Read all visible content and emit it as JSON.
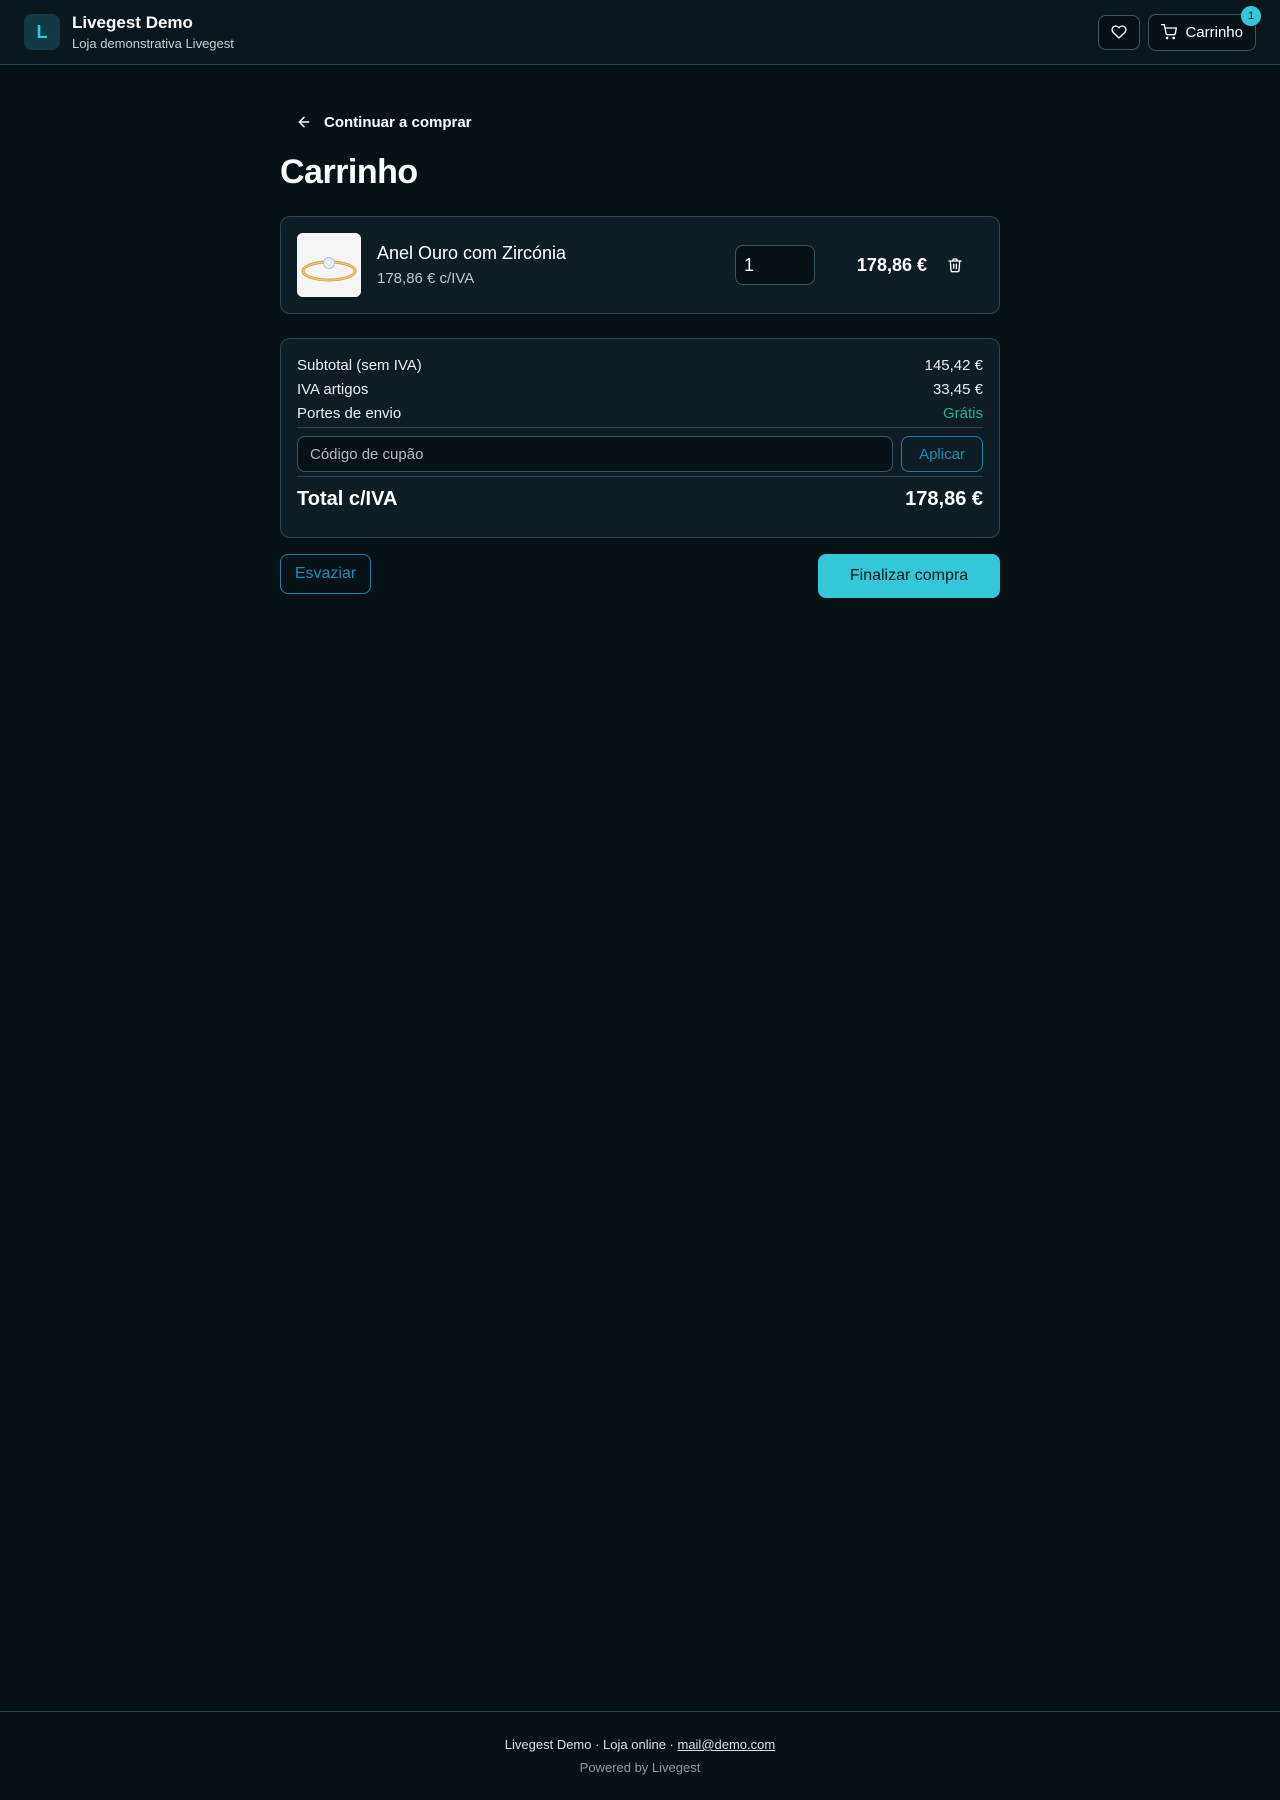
{
  "header": {
    "logo_letter": "L",
    "store_name": "Livegest Demo",
    "store_subtitle": "Loja demonstrativa Livegest",
    "cart_label": "Carrinho",
    "cart_count": "1"
  },
  "nav": {
    "back_label": "Continuar a comprar"
  },
  "page": {
    "title": "Carrinho"
  },
  "cart_items": [
    {
      "name": "Anel Ouro com Zircónia",
      "unit_price": "178,86 € c/IVA",
      "quantity": "1",
      "line_total": "178,86 €"
    }
  ],
  "summary": {
    "subtotal_label": "Subtotal (sem IVA)",
    "subtotal_value": "145,42 €",
    "vat_label": "IVA artigos",
    "vat_value": "33,45 €",
    "shipping_label": "Portes de envio",
    "shipping_value": "Grátis",
    "coupon_placeholder": "Código de cupão",
    "apply_label": "Aplicar",
    "total_label": "Total c/IVA",
    "total_value": "178,86 €"
  },
  "actions": {
    "empty_label": "Esvaziar",
    "checkout_label": "Finalizar compra"
  },
  "footer": {
    "line_prefix": "Livegest Demo · Loja online · ",
    "email": "mail@demo.com",
    "powered": "Powered by Livegest"
  },
  "colors": {
    "background": "#071217",
    "accent": "#34c6d9",
    "link": "#1a8db6",
    "success": "#22b38a"
  }
}
